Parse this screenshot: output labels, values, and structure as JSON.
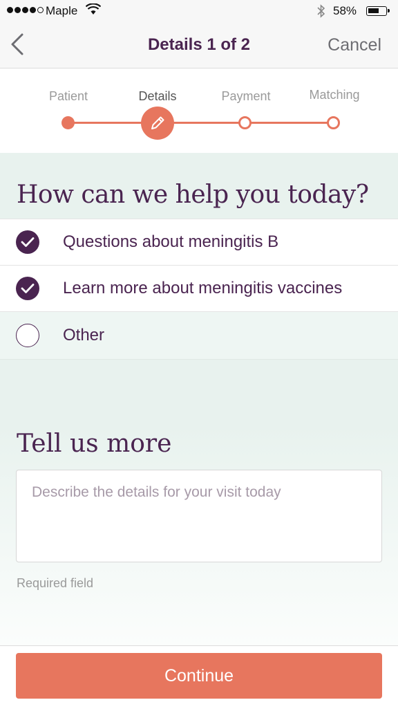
{
  "status_bar": {
    "carrier": "Maple",
    "battery_percent": "58%",
    "battery_level": 0.58,
    "signal_bars": 4
  },
  "nav": {
    "back_icon": "chevron-left-icon",
    "title": "Details 1 of 2",
    "cancel_label": "Cancel"
  },
  "steps": [
    {
      "label": "Patient",
      "state": "done"
    },
    {
      "label": "Details",
      "state": "current",
      "icon": "pencil-icon"
    },
    {
      "label": "Payment",
      "state": "todo"
    },
    {
      "label": "Matching",
      "state": "todo"
    }
  ],
  "help": {
    "heading": "How can we help you today?",
    "options": [
      {
        "label": "Questions about meningitis B",
        "checked": true
      },
      {
        "label": "Learn more about meningitis vaccines",
        "checked": true
      },
      {
        "label": "Other",
        "checked": false
      }
    ]
  },
  "details": {
    "heading": "Tell us more",
    "placeholder": "Describe the details for your visit today",
    "value": "",
    "hint": "Required field"
  },
  "footer": {
    "continue_label": "Continue"
  },
  "colors": {
    "accent": "#e7765e",
    "brand": "#4a2450",
    "background": "#e8f2ee"
  }
}
